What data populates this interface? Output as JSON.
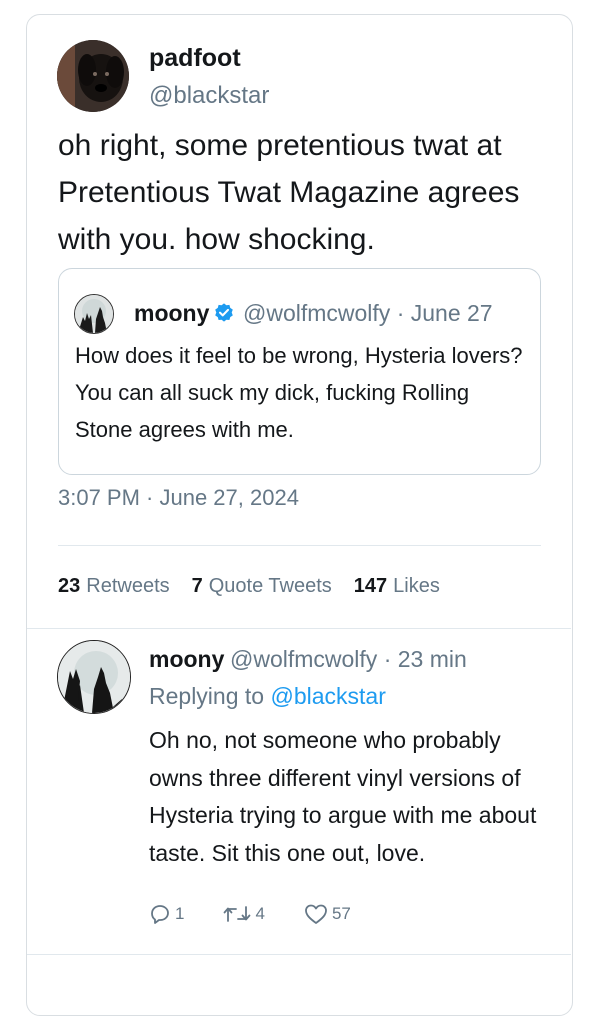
{
  "main_tweet": {
    "display_name": "padfoot",
    "handle": "@blackstar",
    "text": "oh right, some pretentious twat at Pretentious Twat Magazine agrees with you. how shocking.",
    "timestamp": "3:07 PM · June 27, 2024",
    "avatar": "dog-avatar"
  },
  "quoted_tweet": {
    "display_name": "moony",
    "verified": true,
    "meta": "@wolfmcwolfy · June 27",
    "text": "How does it feel to be wrong, Hysteria lovers? You can all suck my dick, fucking Rolling Stone agrees with me.",
    "avatar": "wolf-avatar"
  },
  "stats": {
    "retweets_count": "23",
    "retweets_label": "Retweets",
    "quotes_count": "7",
    "quotes_label": "Quote Tweets",
    "likes_count": "147",
    "likes_label": "Likes"
  },
  "reply": {
    "display_name": "moony",
    "meta": "@wolfmcwolfy · 23 min",
    "replying_prefix": "Replying to",
    "replying_to": "@blackstar",
    "text": "Oh no, not someone who probably owns three different vinyl versions of Hysteria trying to argue with me about taste. Sit this one out, love.",
    "avatar": "wolf-avatar",
    "actions": {
      "reply_count": "1",
      "retweet_count": "4",
      "like_count": "57"
    }
  },
  "colors": {
    "link": "#1d9bf0",
    "muted": "#657786",
    "text": "#14171a",
    "border": "#d9dee2"
  }
}
